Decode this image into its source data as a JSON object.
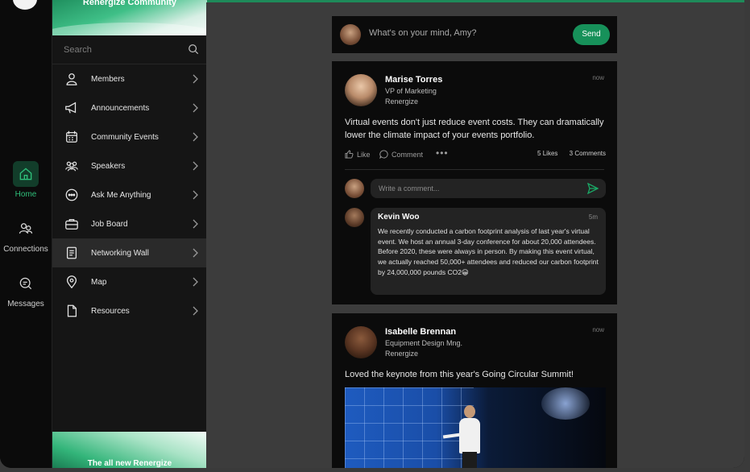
{
  "rail": {
    "items": [
      {
        "label": "Home",
        "icon": "home-icon",
        "active": true
      },
      {
        "label": "Connections",
        "icon": "connections-icon"
      },
      {
        "label": "Messages",
        "icon": "messages-icon"
      }
    ]
  },
  "sidebar": {
    "banner_title": "Renergize Community",
    "search_placeholder": "Search",
    "items": [
      {
        "label": "Members",
        "icon": "person-icon"
      },
      {
        "label": "Announcements",
        "icon": "megaphone-icon"
      },
      {
        "label": "Community Events",
        "icon": "calendar-icon"
      },
      {
        "label": "Speakers",
        "icon": "group-icon"
      },
      {
        "label": "Ask Me Anything",
        "icon": "chat-bubble-icon"
      },
      {
        "label": "Job Board",
        "icon": "briefcase-icon"
      },
      {
        "label": "Networking Wall",
        "icon": "document-icon",
        "active": true
      },
      {
        "label": "Map",
        "icon": "map-pin-icon"
      },
      {
        "label": "Resources",
        "icon": "file-icon"
      }
    ],
    "footer_text": "The all new Renergize"
  },
  "composer": {
    "placeholder": "What's on your mind, Amy?",
    "send_label": "Send"
  },
  "posts": [
    {
      "author": "Marise Torres",
      "role": "VP of Marketing",
      "org": "Renergize",
      "time": "now",
      "text": "Virtual events don't just reduce event costs. They can dramatically lower the climate impact of your events portfolio.",
      "like_label": "Like",
      "comment_label": "Comment",
      "more_label": "•••",
      "likes": "5 Likes",
      "comments": "3 Comments",
      "comment_placeholder": "Write a comment...",
      "reply": {
        "author": "Kevin Woo",
        "time": "5m",
        "text": "We recently conducted a carbon footprint analysis of last year's virtual event. We host an annual 3-day conference for about 20,000 attendees. Before 2020, these were always in person. By making this event virtual, we actually reached 50,000+ attendees and reduced our carbon footprint by 24,000,000 pounds CO2😀"
      }
    },
    {
      "author": "Isabelle Brennan",
      "role": "Equipment Design Mng.",
      "org": "Renergize",
      "time": "now",
      "text": "Loved the keynote from this year's Going Circular Summit!"
    }
  ],
  "colors": {
    "accent": "#17915a",
    "active_rail": "#2fbf7a"
  }
}
